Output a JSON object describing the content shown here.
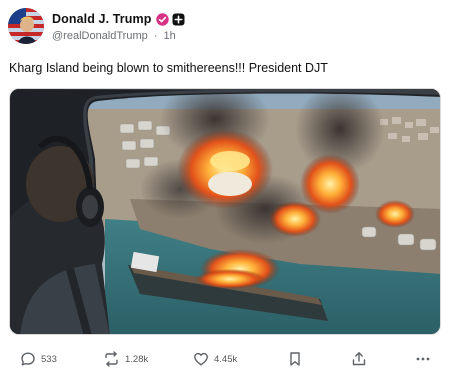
{
  "author": {
    "display_name": "Donald J. Trump",
    "handle": "@realDonaldTrump",
    "separator": "·",
    "time": "1h"
  },
  "post": {
    "text": "Kharg Island being blown to smithereens!!! President DJT"
  },
  "actions": {
    "replies": "533",
    "reposts": "1.28k",
    "likes": "4.45k"
  },
  "colors": {
    "verified_badge": "#d63384",
    "icon_gray": "#5f6368"
  }
}
